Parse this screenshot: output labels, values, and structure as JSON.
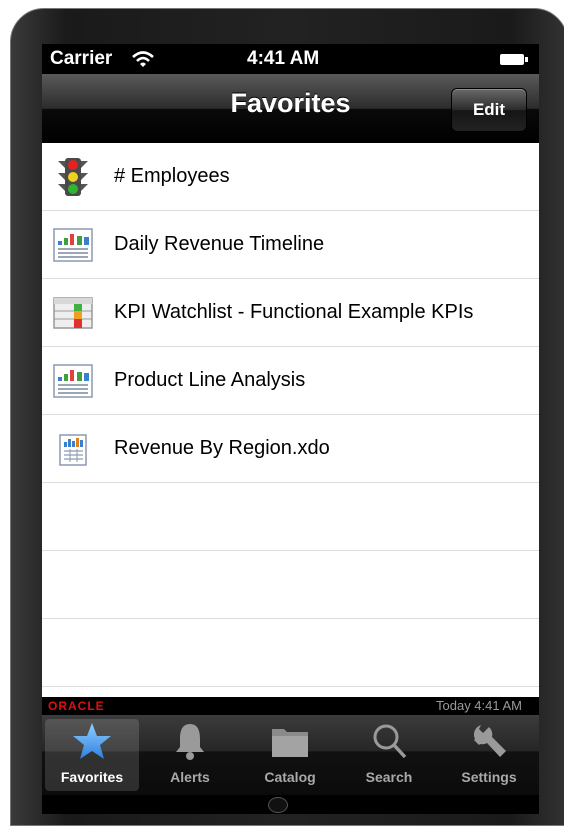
{
  "status_bar": {
    "carrier": "Carrier",
    "time": "4:41 AM"
  },
  "nav_bar": {
    "title": "Favorites",
    "edit_label": "Edit"
  },
  "favorites": [
    {
      "label": "# Employees",
      "icon": "traffic-light-icon"
    },
    {
      "label": "Daily Revenue Timeline",
      "icon": "dashboard-report-icon"
    },
    {
      "label": "KPI Watchlist - Functional Example KPIs",
      "icon": "kpi-watchlist-icon"
    },
    {
      "label": "Product Line Analysis",
      "icon": "dashboard-report-icon"
    },
    {
      "label": "Revenue By Region.xdo",
      "icon": "bi-publisher-report-icon"
    }
  ],
  "footer": {
    "logo": "ORACLE",
    "last_updated": "Today 4:41 AM"
  },
  "tab_bar": {
    "active": "Favorites",
    "tabs": [
      {
        "label": "Favorites",
        "icon": "star-icon"
      },
      {
        "label": "Alerts",
        "icon": "bell-icon"
      },
      {
        "label": "Catalog",
        "icon": "folder-icon"
      },
      {
        "label": "Search",
        "icon": "search-icon"
      },
      {
        "label": "Settings",
        "icon": "wrench-icon"
      }
    ]
  },
  "colors": {
    "oracle_red": "#e01010",
    "star_blue": "#3a8ee8",
    "inactive_tab": "#a9a9a9"
  }
}
